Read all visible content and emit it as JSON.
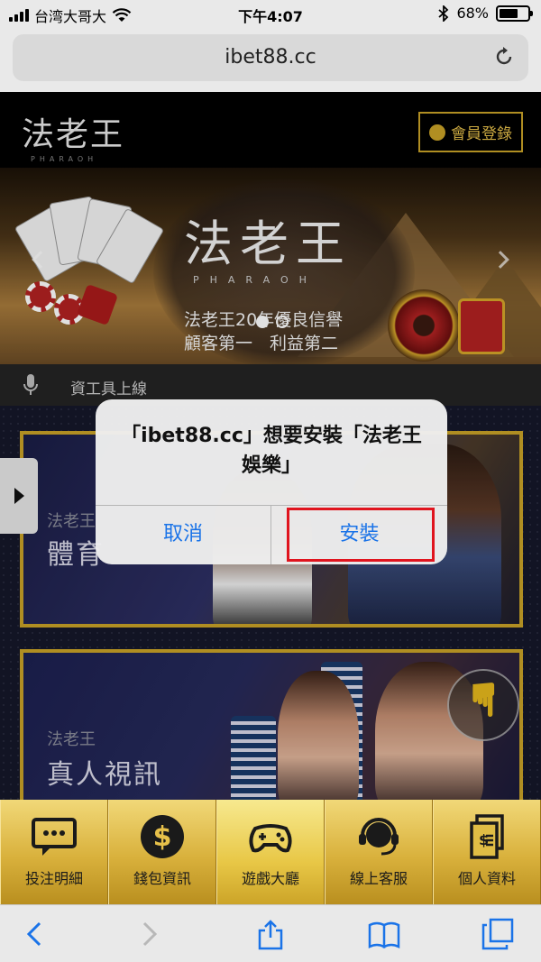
{
  "status_bar": {
    "carrier": "台湾大哥大",
    "time": "下午4:07",
    "battery_percent": "68%",
    "battery_level": 0.68
  },
  "browser": {
    "url": "ibet88.cc"
  },
  "site": {
    "logo_main": "法老王",
    "logo_sub": "PHARAOH",
    "member_login": "會員登錄"
  },
  "banner": {
    "logo_main": "法老王",
    "logo_sub": "PHARAOH",
    "line1": "法老王20年優良信譽",
    "line2": "顧客第一　利益第二"
  },
  "marquee": {
    "text": "資工具上線"
  },
  "games": [
    {
      "brand": "法老王",
      "title": "體育"
    },
    {
      "brand": "法老王",
      "title": "真人視訊"
    }
  ],
  "alert": {
    "message": "「ibet88.cc」想要安裝「法老王娛樂」",
    "cancel_label": "取消",
    "install_label": "安裝"
  },
  "bottom_nav": {
    "items": [
      {
        "label": "投注明細",
        "icon": "chat-bubble-icon"
      },
      {
        "label": "錢包資訊",
        "icon": "dollar-coin-icon"
      },
      {
        "label": "遊戲大廳",
        "icon": "gamepad-icon"
      },
      {
        "label": "線上客服",
        "icon": "headset-icon"
      },
      {
        "label": "個人資料",
        "icon": "documents-icon"
      }
    ],
    "active_index": 2
  },
  "colors": {
    "gold": "#c9a227",
    "ios_blue": "#1a73e8",
    "highlight_red": "#e0141e"
  }
}
